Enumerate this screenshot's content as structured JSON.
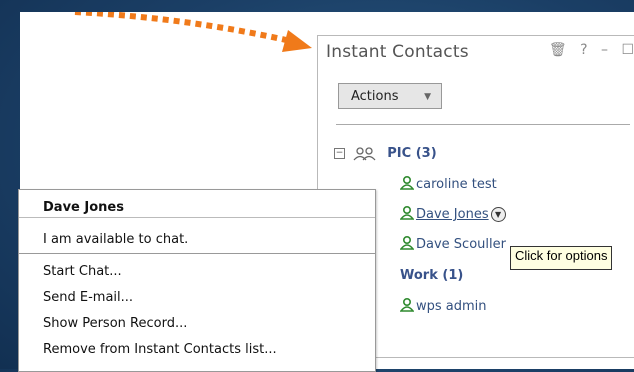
{
  "portlet": {
    "title": "Instant Contacts",
    "icons": [
      "trash-icon",
      "help-icon",
      "minimize-icon",
      "maximize-icon"
    ],
    "actions_label": "Actions"
  },
  "tree": {
    "groups": [
      {
        "label": "PIC (3)",
        "contacts": [
          "caroline test",
          "Dave Jones",
          "Dave Scouller"
        ]
      },
      {
        "label": "Work (1)",
        "contacts": [
          "wps admin"
        ]
      }
    ]
  },
  "tooltip": "Click for options",
  "menu": {
    "name": "Dave Jones",
    "status": "I am available to chat.",
    "items": [
      "Start Chat...",
      "Send E-mail...",
      "Show Person Record...",
      "Remove from Instant Contacts list..."
    ]
  },
  "colors": {
    "accent_arrow": "#f07a1a",
    "group_text": "#38528a",
    "online_icon": "#2f8a2f"
  }
}
